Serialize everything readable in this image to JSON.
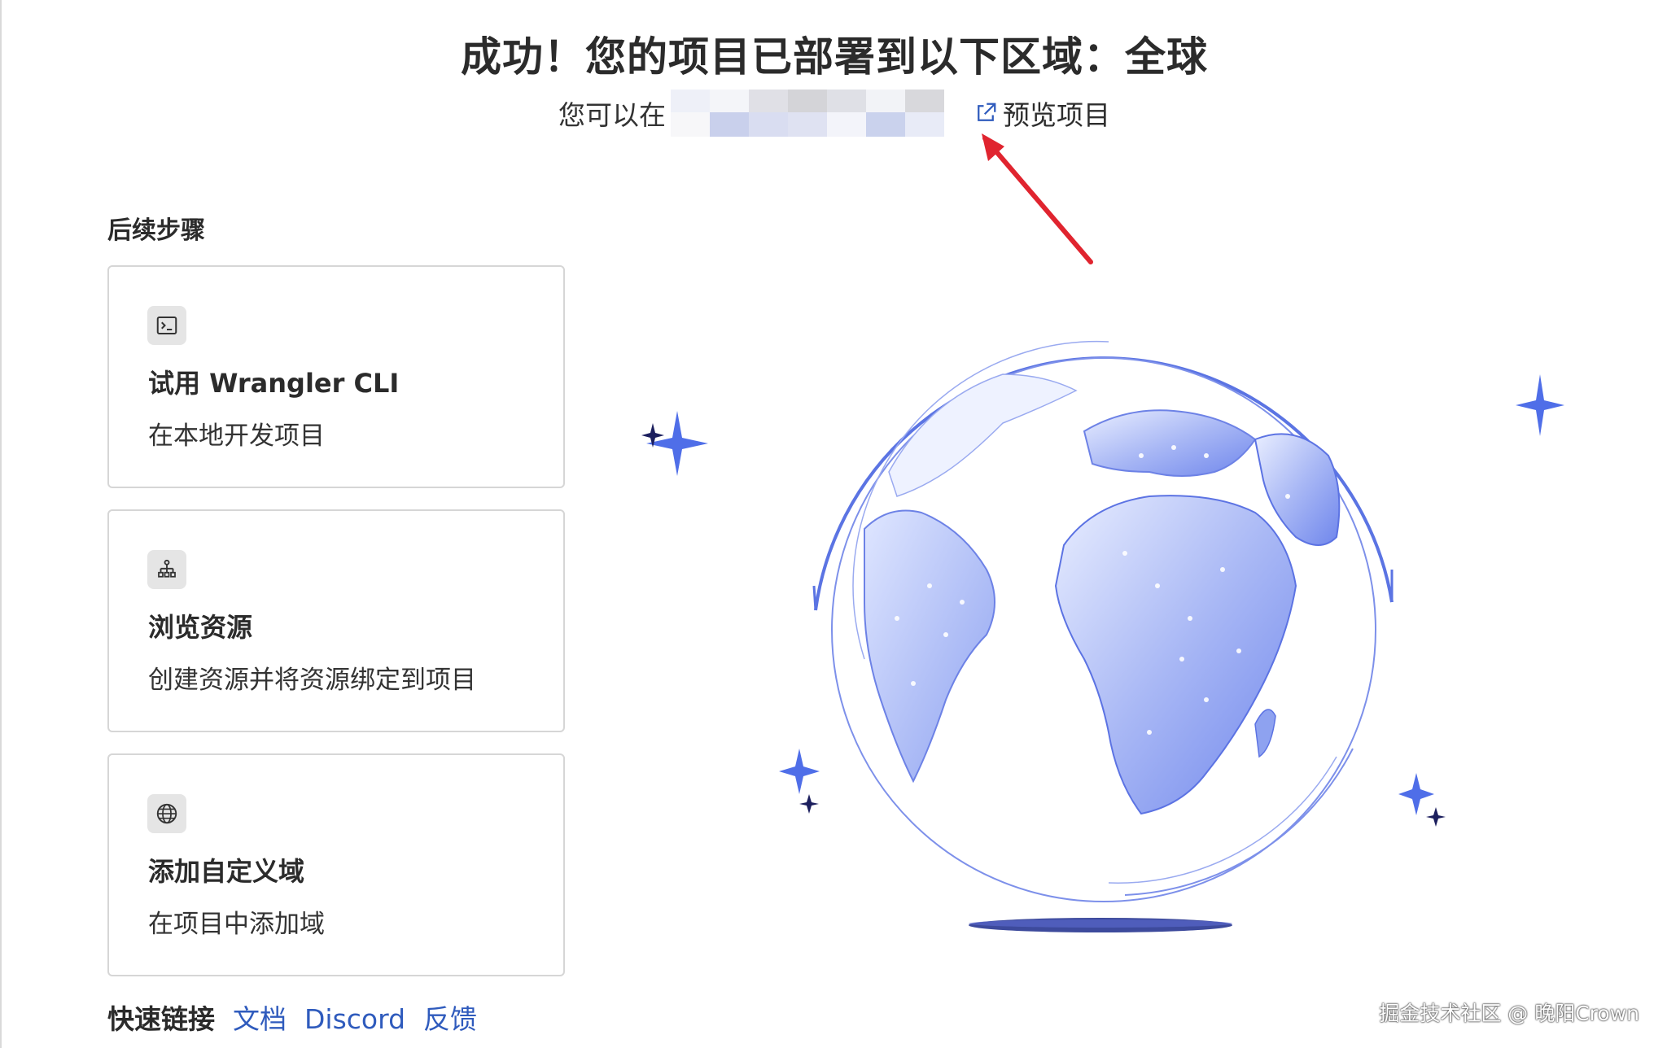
{
  "header": {
    "headline": "成功！您的项目已部署到以下区域：全球",
    "sub_prefix": "您可以在",
    "preview_label": "预览项目"
  },
  "steps": {
    "title": "后续步骤",
    "cards": [
      {
        "title": "试用 Wrangler CLI",
        "desc": "在本地开发项目",
        "icon": "terminal-icon"
      },
      {
        "title": "浏览资源",
        "desc": "创建资源并将资源绑定到项目",
        "icon": "sitemap-icon"
      },
      {
        "title": "添加自定义域",
        "desc": "在项目中添加域",
        "icon": "globe-icon"
      }
    ]
  },
  "quick_links": {
    "label": "快速链接",
    "links": [
      "文档",
      "Discord",
      "反馈"
    ]
  },
  "watermark": "掘金技术社区 @ 晚阳Crown",
  "colors": {
    "accent_blue": "#2f5bbd",
    "globe_fill": "#7f96ef",
    "sparkle": "#4f6ee8",
    "arrow_red": "#e0242f"
  }
}
